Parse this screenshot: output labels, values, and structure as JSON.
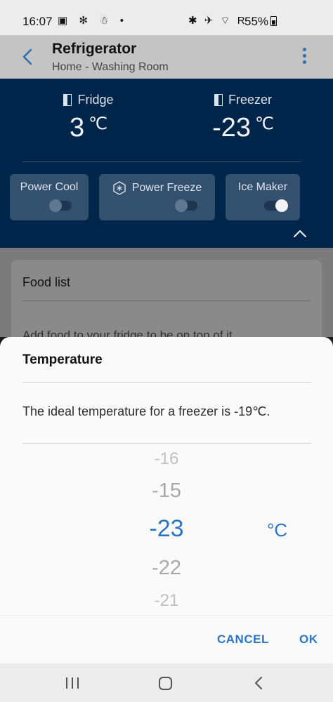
{
  "status_bar": {
    "time": "16:07",
    "left_icons": "▣ ✻ ☃ •",
    "right_icons": "✱ ✈ ⌔ R",
    "battery": "55%"
  },
  "app_bar": {
    "title": "Refrigerator",
    "subtitle": "Home - Washing Room"
  },
  "compartments": [
    {
      "label": "Fridge",
      "value": "3",
      "unit": "℃"
    },
    {
      "label": "Freezer",
      "value": "-23",
      "unit": "℃"
    }
  ],
  "toggles": [
    {
      "label": "Power Cool",
      "on": false
    },
    {
      "label": "Power Freeze",
      "on": false
    },
    {
      "label": "Ice Maker",
      "on": true
    }
  ],
  "food_list": {
    "title": "Food list",
    "hint": "Add food to your fridge to be on top of it"
  },
  "temperature_sheet": {
    "title": "Temperature",
    "message": "The ideal temperature for a freezer is -19℃.",
    "picker_values": [
      "-16",
      "-15",
      "-23",
      "-22",
      "-21"
    ],
    "selected_value": "-23",
    "unit": "°C",
    "cancel_label": "CANCEL",
    "ok_label": "OK"
  },
  "colors": {
    "accent": "#2b75c2",
    "panel": "#00254a"
  }
}
